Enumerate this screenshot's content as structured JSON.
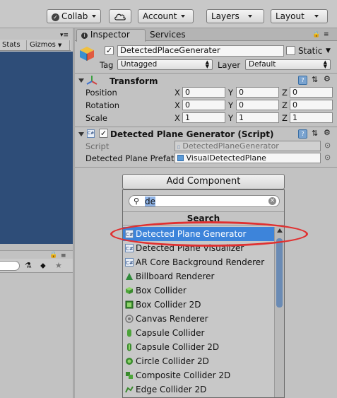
{
  "toolbar": {
    "collab_label": "Collab",
    "account_label": "Account",
    "layers_label": "Layers",
    "layout_label": "Layout"
  },
  "left_panel": {
    "stats_label": "Stats",
    "gizmos_label": "Gizmos"
  },
  "inspector": {
    "tab_inspector": "Inspector",
    "tab_services": "Services",
    "object_name": "DetectedPlaceGenerater",
    "static_label": "Static",
    "tag_label": "Tag",
    "tag_value": "Untagged",
    "layer_label": "Layer",
    "layer_value": "Default",
    "transform": {
      "title": "Transform",
      "rows": [
        {
          "label": "Position",
          "x": "0",
          "y": "0",
          "z": "0"
        },
        {
          "label": "Rotation",
          "x": "0",
          "y": "0",
          "z": "0"
        },
        {
          "label": "Scale",
          "x": "1",
          "y": "1",
          "z": "1"
        }
      ],
      "axis_x": "X",
      "axis_y": "Y",
      "axis_z": "Z"
    },
    "script_component": {
      "title": "Detected Plane Generator (Script)",
      "script_label": "Script",
      "script_value": "DetectedPlaneGenerator",
      "prefab_label": "Detected Plane Prefat",
      "prefab_value": "VisualDetectedPlane"
    }
  },
  "add_component": {
    "button_label": "Add Component",
    "search_value": "de",
    "search_heading": "Search",
    "items": [
      {
        "label": "Detected Plane Generator",
        "icon": "script-icon",
        "selected": true
      },
      {
        "label": "Detected Plane Visualizer",
        "icon": "script-icon"
      },
      {
        "label": "AR Core Background Renderer",
        "icon": "script-icon"
      },
      {
        "label": "Billboard Renderer",
        "icon": "billboard-icon"
      },
      {
        "label": "Box Collider",
        "icon": "box-collider-icon"
      },
      {
        "label": "Box Collider 2D",
        "icon": "box-collider-2d-icon"
      },
      {
        "label": "Canvas Renderer",
        "icon": "canvas-renderer-icon"
      },
      {
        "label": "Capsule Collider",
        "icon": "capsule-collider-icon"
      },
      {
        "label": "Capsule Collider 2D",
        "icon": "capsule-collider-2d-icon"
      },
      {
        "label": "Circle Collider 2D",
        "icon": "circle-collider-icon"
      },
      {
        "label": "Composite Collider 2D",
        "icon": "composite-collider-icon"
      },
      {
        "label": "Edge Collider 2D",
        "icon": "edge-collider-icon"
      }
    ]
  },
  "colors": {
    "selection": "#3d84da",
    "annotation": "#e03030",
    "scene_background": "#2e4d78"
  }
}
